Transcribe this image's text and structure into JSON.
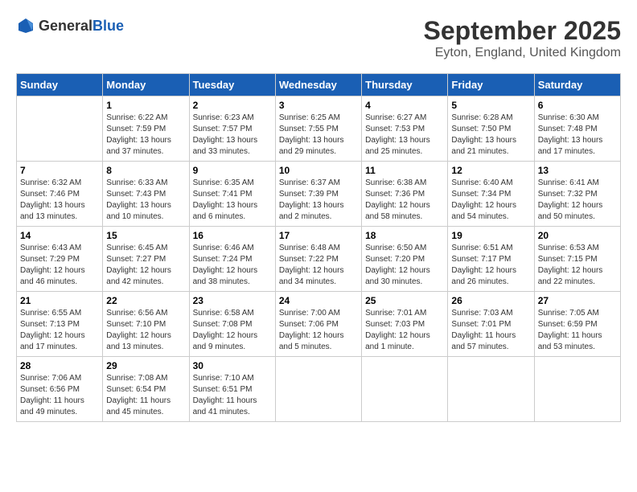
{
  "header": {
    "logo": {
      "text_general": "General",
      "text_blue": "Blue"
    },
    "month_title": "September 2025",
    "location": "Eyton, England, United Kingdom"
  },
  "calendar": {
    "weekdays": [
      "Sunday",
      "Monday",
      "Tuesday",
      "Wednesday",
      "Thursday",
      "Friday",
      "Saturday"
    ],
    "weeks": [
      [
        {
          "day": "",
          "sunrise": "",
          "sunset": "",
          "daylight": ""
        },
        {
          "day": "1",
          "sunrise": "Sunrise: 6:22 AM",
          "sunset": "Sunset: 7:59 PM",
          "daylight": "Daylight: 13 hours and 37 minutes."
        },
        {
          "day": "2",
          "sunrise": "Sunrise: 6:23 AM",
          "sunset": "Sunset: 7:57 PM",
          "daylight": "Daylight: 13 hours and 33 minutes."
        },
        {
          "day": "3",
          "sunrise": "Sunrise: 6:25 AM",
          "sunset": "Sunset: 7:55 PM",
          "daylight": "Daylight: 13 hours and 29 minutes."
        },
        {
          "day": "4",
          "sunrise": "Sunrise: 6:27 AM",
          "sunset": "Sunset: 7:53 PM",
          "daylight": "Daylight: 13 hours and 25 minutes."
        },
        {
          "day": "5",
          "sunrise": "Sunrise: 6:28 AM",
          "sunset": "Sunset: 7:50 PM",
          "daylight": "Daylight: 13 hours and 21 minutes."
        },
        {
          "day": "6",
          "sunrise": "Sunrise: 6:30 AM",
          "sunset": "Sunset: 7:48 PM",
          "daylight": "Daylight: 13 hours and 17 minutes."
        }
      ],
      [
        {
          "day": "7",
          "sunrise": "Sunrise: 6:32 AM",
          "sunset": "Sunset: 7:46 PM",
          "daylight": "Daylight: 13 hours and 13 minutes."
        },
        {
          "day": "8",
          "sunrise": "Sunrise: 6:33 AM",
          "sunset": "Sunset: 7:43 PM",
          "daylight": "Daylight: 13 hours and 10 minutes."
        },
        {
          "day": "9",
          "sunrise": "Sunrise: 6:35 AM",
          "sunset": "Sunset: 7:41 PM",
          "daylight": "Daylight: 13 hours and 6 minutes."
        },
        {
          "day": "10",
          "sunrise": "Sunrise: 6:37 AM",
          "sunset": "Sunset: 7:39 PM",
          "daylight": "Daylight: 13 hours and 2 minutes."
        },
        {
          "day": "11",
          "sunrise": "Sunrise: 6:38 AM",
          "sunset": "Sunset: 7:36 PM",
          "daylight": "Daylight: 12 hours and 58 minutes."
        },
        {
          "day": "12",
          "sunrise": "Sunrise: 6:40 AM",
          "sunset": "Sunset: 7:34 PM",
          "daylight": "Daylight: 12 hours and 54 minutes."
        },
        {
          "day": "13",
          "sunrise": "Sunrise: 6:41 AM",
          "sunset": "Sunset: 7:32 PM",
          "daylight": "Daylight: 12 hours and 50 minutes."
        }
      ],
      [
        {
          "day": "14",
          "sunrise": "Sunrise: 6:43 AM",
          "sunset": "Sunset: 7:29 PM",
          "daylight": "Daylight: 12 hours and 46 minutes."
        },
        {
          "day": "15",
          "sunrise": "Sunrise: 6:45 AM",
          "sunset": "Sunset: 7:27 PM",
          "daylight": "Daylight: 12 hours and 42 minutes."
        },
        {
          "day": "16",
          "sunrise": "Sunrise: 6:46 AM",
          "sunset": "Sunset: 7:24 PM",
          "daylight": "Daylight: 12 hours and 38 minutes."
        },
        {
          "day": "17",
          "sunrise": "Sunrise: 6:48 AM",
          "sunset": "Sunset: 7:22 PM",
          "daylight": "Daylight: 12 hours and 34 minutes."
        },
        {
          "day": "18",
          "sunrise": "Sunrise: 6:50 AM",
          "sunset": "Sunset: 7:20 PM",
          "daylight": "Daylight: 12 hours and 30 minutes."
        },
        {
          "day": "19",
          "sunrise": "Sunrise: 6:51 AM",
          "sunset": "Sunset: 7:17 PM",
          "daylight": "Daylight: 12 hours and 26 minutes."
        },
        {
          "day": "20",
          "sunrise": "Sunrise: 6:53 AM",
          "sunset": "Sunset: 7:15 PM",
          "daylight": "Daylight: 12 hours and 22 minutes."
        }
      ],
      [
        {
          "day": "21",
          "sunrise": "Sunrise: 6:55 AM",
          "sunset": "Sunset: 7:13 PM",
          "daylight": "Daylight: 12 hours and 17 minutes."
        },
        {
          "day": "22",
          "sunrise": "Sunrise: 6:56 AM",
          "sunset": "Sunset: 7:10 PM",
          "daylight": "Daylight: 12 hours and 13 minutes."
        },
        {
          "day": "23",
          "sunrise": "Sunrise: 6:58 AM",
          "sunset": "Sunset: 7:08 PM",
          "daylight": "Daylight: 12 hours and 9 minutes."
        },
        {
          "day": "24",
          "sunrise": "Sunrise: 7:00 AM",
          "sunset": "Sunset: 7:06 PM",
          "daylight": "Daylight: 12 hours and 5 minutes."
        },
        {
          "day": "25",
          "sunrise": "Sunrise: 7:01 AM",
          "sunset": "Sunset: 7:03 PM",
          "daylight": "Daylight: 12 hours and 1 minute."
        },
        {
          "day": "26",
          "sunrise": "Sunrise: 7:03 AM",
          "sunset": "Sunset: 7:01 PM",
          "daylight": "Daylight: 11 hours and 57 minutes."
        },
        {
          "day": "27",
          "sunrise": "Sunrise: 7:05 AM",
          "sunset": "Sunset: 6:59 PM",
          "daylight": "Daylight: 11 hours and 53 minutes."
        }
      ],
      [
        {
          "day": "28",
          "sunrise": "Sunrise: 7:06 AM",
          "sunset": "Sunset: 6:56 PM",
          "daylight": "Daylight: 11 hours and 49 minutes."
        },
        {
          "day": "29",
          "sunrise": "Sunrise: 7:08 AM",
          "sunset": "Sunset: 6:54 PM",
          "daylight": "Daylight: 11 hours and 45 minutes."
        },
        {
          "day": "30",
          "sunrise": "Sunrise: 7:10 AM",
          "sunset": "Sunset: 6:51 PM",
          "daylight": "Daylight: 11 hours and 41 minutes."
        },
        {
          "day": "",
          "sunrise": "",
          "sunset": "",
          "daylight": ""
        },
        {
          "day": "",
          "sunrise": "",
          "sunset": "",
          "daylight": ""
        },
        {
          "day": "",
          "sunrise": "",
          "sunset": "",
          "daylight": ""
        },
        {
          "day": "",
          "sunrise": "",
          "sunset": "",
          "daylight": ""
        }
      ]
    ]
  }
}
